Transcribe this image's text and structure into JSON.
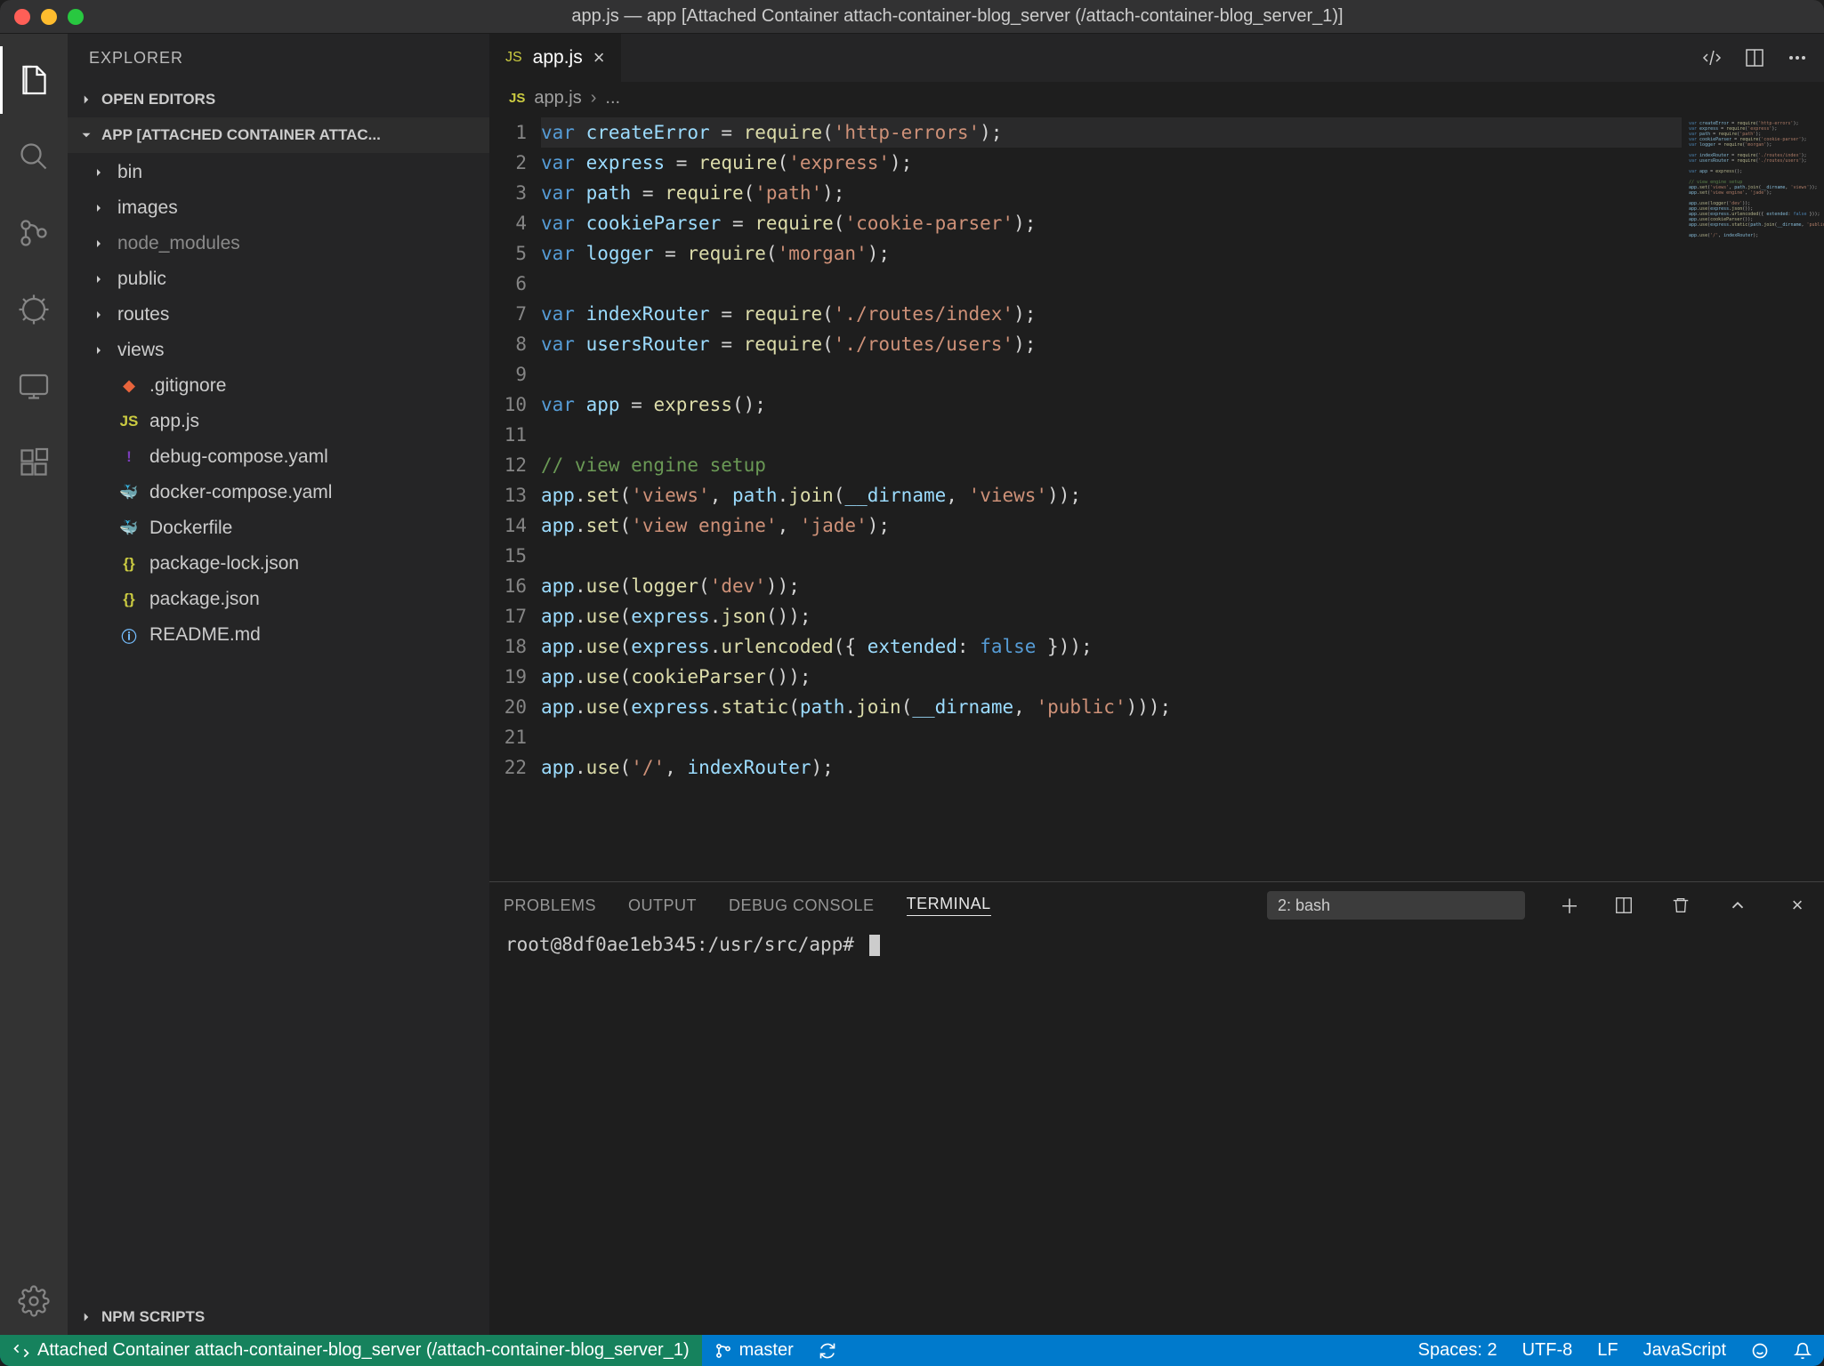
{
  "title": "app.js — app [Attached Container attach-container-blog_server (/attach-container-blog_server_1)]",
  "sidebar": {
    "title": "EXPLORER",
    "openEditors": "OPEN EDITORS",
    "project": "APP [ATTACHED CONTAINER ATTAC...",
    "npmScripts": "NPM SCRIPTS",
    "folders": [
      {
        "name": "bin"
      },
      {
        "name": "images"
      },
      {
        "name": "node_modules",
        "dim": true
      },
      {
        "name": "public"
      },
      {
        "name": "routes"
      },
      {
        "name": "views"
      }
    ],
    "files": [
      {
        "name": ".gitignore",
        "cls": "ic-git",
        "glyph": "◆"
      },
      {
        "name": "app.js",
        "cls": "ic-js",
        "glyph": "JS"
      },
      {
        "name": "debug-compose.yaml",
        "cls": "ic-yaml",
        "glyph": "!"
      },
      {
        "name": "docker-compose.yaml",
        "cls": "ic-whale",
        "glyph": "🐳"
      },
      {
        "name": "Dockerfile",
        "cls": "ic-docker",
        "glyph": "🐳"
      },
      {
        "name": "package-lock.json",
        "cls": "ic-json",
        "glyph": "{}"
      },
      {
        "name": "package.json",
        "cls": "ic-json",
        "glyph": "{}"
      },
      {
        "name": "README.md",
        "cls": "ic-info",
        "glyph": "ⓘ"
      }
    ]
  },
  "tab": {
    "icon": "JS",
    "label": "app.js"
  },
  "breadcrumb": {
    "icon": "JS",
    "file": "app.js",
    "more": "..."
  },
  "code": {
    "lines": [
      [
        [
          "kw",
          "var"
        ],
        [
          "punc",
          " "
        ],
        [
          "id",
          "createError"
        ],
        [
          "punc",
          " = "
        ],
        [
          "fn",
          "require"
        ],
        [
          "punc",
          "("
        ],
        [
          "str",
          "'http-errors'"
        ],
        [
          "punc",
          ");"
        ]
      ],
      [
        [
          "kw",
          "var"
        ],
        [
          "punc",
          " "
        ],
        [
          "id",
          "express"
        ],
        [
          "punc",
          " = "
        ],
        [
          "fn",
          "require"
        ],
        [
          "punc",
          "("
        ],
        [
          "str",
          "'express'"
        ],
        [
          "punc",
          ");"
        ]
      ],
      [
        [
          "kw",
          "var"
        ],
        [
          "punc",
          " "
        ],
        [
          "id",
          "path"
        ],
        [
          "punc",
          " = "
        ],
        [
          "fn",
          "require"
        ],
        [
          "punc",
          "("
        ],
        [
          "str",
          "'path'"
        ],
        [
          "punc",
          ");"
        ]
      ],
      [
        [
          "kw",
          "var"
        ],
        [
          "punc",
          " "
        ],
        [
          "id",
          "cookieParser"
        ],
        [
          "punc",
          " = "
        ],
        [
          "fn",
          "require"
        ],
        [
          "punc",
          "("
        ],
        [
          "str",
          "'cookie-parser'"
        ],
        [
          "punc",
          ");"
        ]
      ],
      [
        [
          "kw",
          "var"
        ],
        [
          "punc",
          " "
        ],
        [
          "id",
          "logger"
        ],
        [
          "punc",
          " = "
        ],
        [
          "fn",
          "require"
        ],
        [
          "punc",
          "("
        ],
        [
          "str",
          "'morgan'"
        ],
        [
          "punc",
          ");"
        ]
      ],
      [],
      [
        [
          "kw",
          "var"
        ],
        [
          "punc",
          " "
        ],
        [
          "id",
          "indexRouter"
        ],
        [
          "punc",
          " = "
        ],
        [
          "fn",
          "require"
        ],
        [
          "punc",
          "("
        ],
        [
          "str",
          "'./routes/index'"
        ],
        [
          "punc",
          ");"
        ]
      ],
      [
        [
          "kw",
          "var"
        ],
        [
          "punc",
          " "
        ],
        [
          "id",
          "usersRouter"
        ],
        [
          "punc",
          " = "
        ],
        [
          "fn",
          "require"
        ],
        [
          "punc",
          "("
        ],
        [
          "str",
          "'./routes/users'"
        ],
        [
          "punc",
          ");"
        ]
      ],
      [],
      [
        [
          "kw",
          "var"
        ],
        [
          "punc",
          " "
        ],
        [
          "id",
          "app"
        ],
        [
          "punc",
          " = "
        ],
        [
          "fn",
          "express"
        ],
        [
          "punc",
          "();"
        ]
      ],
      [],
      [
        [
          "comm",
          "// view engine setup"
        ]
      ],
      [
        [
          "id",
          "app"
        ],
        [
          "punc",
          "."
        ],
        [
          "fn",
          "set"
        ],
        [
          "punc",
          "("
        ],
        [
          "str",
          "'views'"
        ],
        [
          "punc",
          ", "
        ],
        [
          "id",
          "path"
        ],
        [
          "punc",
          "."
        ],
        [
          "fn",
          "join"
        ],
        [
          "punc",
          "("
        ],
        [
          "id",
          "__dirname"
        ],
        [
          "punc",
          ", "
        ],
        [
          "str",
          "'views'"
        ],
        [
          "punc",
          "));"
        ]
      ],
      [
        [
          "id",
          "app"
        ],
        [
          "punc",
          "."
        ],
        [
          "fn",
          "set"
        ],
        [
          "punc",
          "("
        ],
        [
          "str",
          "'view engine'"
        ],
        [
          "punc",
          ", "
        ],
        [
          "str",
          "'jade'"
        ],
        [
          "punc",
          ");"
        ]
      ],
      [],
      [
        [
          "id",
          "app"
        ],
        [
          "punc",
          "."
        ],
        [
          "fn",
          "use"
        ],
        [
          "punc",
          "("
        ],
        [
          "fn",
          "logger"
        ],
        [
          "punc",
          "("
        ],
        [
          "str",
          "'dev'"
        ],
        [
          "punc",
          "));"
        ]
      ],
      [
        [
          "id",
          "app"
        ],
        [
          "punc",
          "."
        ],
        [
          "fn",
          "use"
        ],
        [
          "punc",
          "("
        ],
        [
          "id",
          "express"
        ],
        [
          "punc",
          "."
        ],
        [
          "fn",
          "json"
        ],
        [
          "punc",
          "());"
        ]
      ],
      [
        [
          "id",
          "app"
        ],
        [
          "punc",
          "."
        ],
        [
          "fn",
          "use"
        ],
        [
          "punc",
          "("
        ],
        [
          "id",
          "express"
        ],
        [
          "punc",
          "."
        ],
        [
          "fn",
          "urlencoded"
        ],
        [
          "punc",
          "({ "
        ],
        [
          "prop",
          "extended"
        ],
        [
          "punc",
          ": "
        ],
        [
          "const",
          "false"
        ],
        [
          "punc",
          " }));"
        ]
      ],
      [
        [
          "id",
          "app"
        ],
        [
          "punc",
          "."
        ],
        [
          "fn",
          "use"
        ],
        [
          "punc",
          "("
        ],
        [
          "fn",
          "cookieParser"
        ],
        [
          "punc",
          "());"
        ]
      ],
      [
        [
          "id",
          "app"
        ],
        [
          "punc",
          "."
        ],
        [
          "fn",
          "use"
        ],
        [
          "punc",
          "("
        ],
        [
          "id",
          "express"
        ],
        [
          "punc",
          "."
        ],
        [
          "fn",
          "static"
        ],
        [
          "punc",
          "("
        ],
        [
          "id",
          "path"
        ],
        [
          "punc",
          "."
        ],
        [
          "fn",
          "join"
        ],
        [
          "punc",
          "("
        ],
        [
          "id",
          "__dirname"
        ],
        [
          "punc",
          ", "
        ],
        [
          "str",
          "'public'"
        ],
        [
          "punc",
          ")));"
        ]
      ],
      [],
      [
        [
          "id",
          "app"
        ],
        [
          "punc",
          "."
        ],
        [
          "fn",
          "use"
        ],
        [
          "punc",
          "("
        ],
        [
          "str",
          "'/'"
        ],
        [
          "punc",
          ", "
        ],
        [
          "id",
          "indexRouter"
        ],
        [
          "punc",
          ");"
        ]
      ]
    ]
  },
  "panel": {
    "tabs": {
      "problems": "PROBLEMS",
      "output": "OUTPUT",
      "debug": "DEBUG CONSOLE",
      "terminal": "TERMINAL"
    },
    "terminalSelect": "2: bash",
    "prompt": "root@8df0ae1eb345:/usr/src/app#"
  },
  "status": {
    "remote": "Attached Container attach-container-blog_server (/attach-container-blog_server_1)",
    "branch": "master",
    "spaces": "Spaces: 2",
    "encoding": "UTF-8",
    "eol": "LF",
    "lang": "JavaScript"
  }
}
